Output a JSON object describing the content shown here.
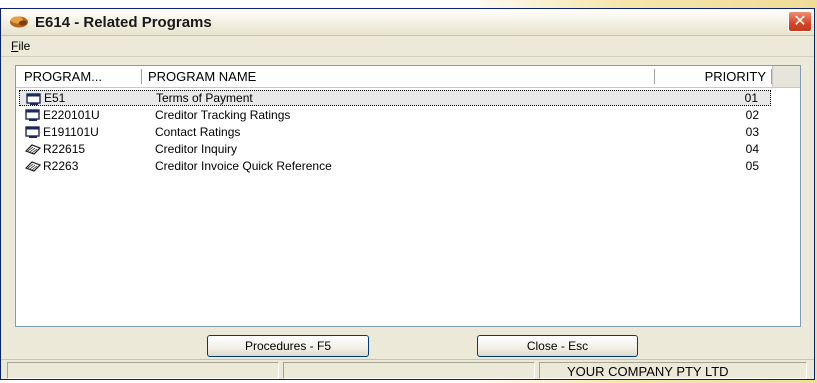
{
  "window": {
    "title": "E614 - Related Programs",
    "close_glyph": "✕"
  },
  "menu": {
    "file_first": "F",
    "file_rest": "ile"
  },
  "list": {
    "columns": [
      "PROGRAM...",
      "PROGRAM NAME",
      "PRIORITY"
    ],
    "rows": [
      {
        "icon": "screen-icon",
        "code": "E51",
        "name": "Terms of Payment",
        "priority": "01"
      },
      {
        "icon": "screen-icon",
        "code": "E220101U",
        "name": "Creditor Tracking Ratings",
        "priority": "02"
      },
      {
        "icon": "screen-icon",
        "code": "E191101U",
        "name": "Contact Ratings",
        "priority": "03"
      },
      {
        "icon": "report-icon",
        "code": "R22615",
        "name": "Creditor Inquiry",
        "priority": "04"
      },
      {
        "icon": "report-icon",
        "code": "R2263",
        "name": "Creditor Invoice Quick Reference",
        "priority": "05"
      }
    ]
  },
  "buttons": {
    "procedures": "Procedures - F5",
    "close": "Close - Esc"
  },
  "status": {
    "company": "YOUR COMPANY PTY LTD"
  },
  "colors": {
    "window_bg": "#ece9d8",
    "close_red": "#d6452a",
    "border_blue": "#003c74"
  }
}
